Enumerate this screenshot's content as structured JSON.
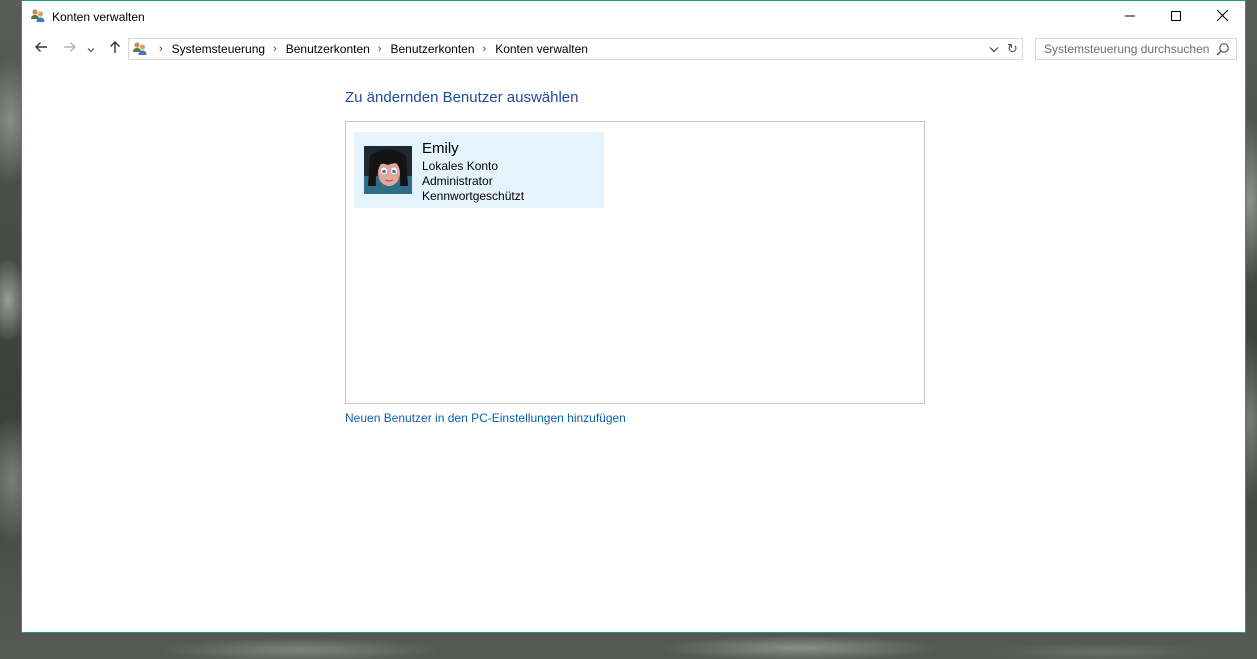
{
  "window": {
    "title": "Konten verwalten",
    "accent_color": "#1a9a8a"
  },
  "titlebar_buttons": {
    "minimize_icon": "minimize-icon",
    "maximize_icon": "maximize-icon",
    "close_icon": "close-icon"
  },
  "toolbar": {
    "back_icon": "arrow-left-icon",
    "forward_icon": "arrow-right-icon",
    "recent_icon": "chevron-down-icon",
    "up_icon": "arrow-up-icon",
    "breadcrumbs": [
      "Systemsteuerung",
      "Benutzerkonten",
      "Benutzerkonten",
      "Konten verwalten"
    ],
    "search_placeholder": "Systemsteuerung durchsuchen"
  },
  "main": {
    "heading": "Zu ändernden Benutzer auswählen",
    "heading_color": "#1e4b9b",
    "users": [
      {
        "name": "Emily",
        "account_type": "Lokales Konto",
        "role": "Administrator",
        "protection": "Kennwortgeschützt"
      }
    ],
    "selected_tile_color": "#e5f3fd",
    "add_user_link": "Neuen Benutzer in den PC-Einstellungen hinzufügen",
    "link_color": "#0f5fb3"
  }
}
